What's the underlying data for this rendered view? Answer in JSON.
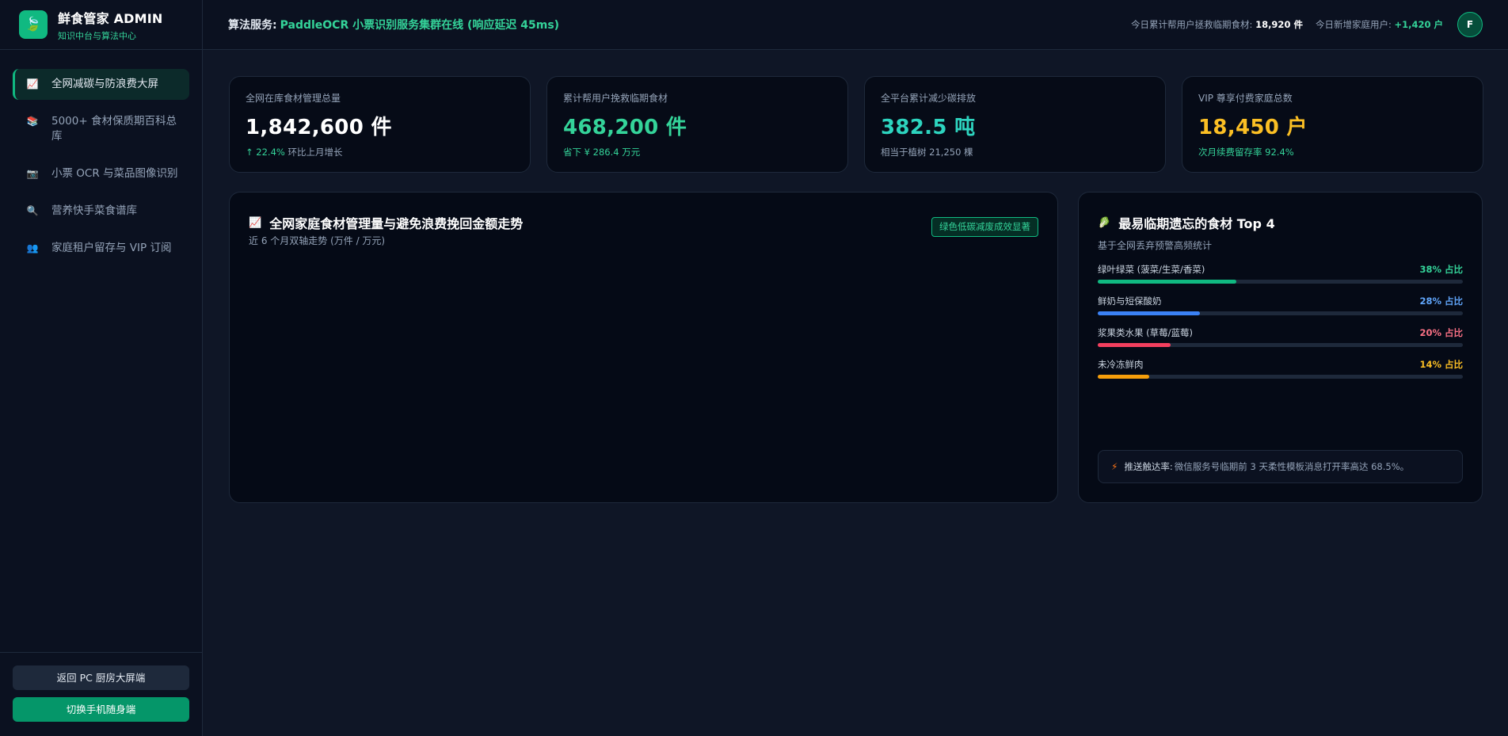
{
  "brand": {
    "title": "鲜食管家 ADMIN",
    "subtitle": "知识中台与算法中心",
    "logo_icon": "leaf-icon"
  },
  "nav": [
    {
      "label": "全网减碳与防浪费大屏",
      "icon": "chart-up-icon",
      "glyph": "📈",
      "active": true
    },
    {
      "label": "5000+ 食材保质期百科总库",
      "icon": "books-icon",
      "glyph": "📚",
      "active": false
    },
    {
      "label": "小票 OCR 与菜品图像识别",
      "icon": "camera-icon",
      "glyph": "📷",
      "active": false
    },
    {
      "label": "营养快手菜食谱库",
      "icon": "magnifier-icon",
      "glyph": "🔍",
      "active": false
    },
    {
      "label": "家庭租户留存与 VIP 订阅",
      "icon": "users-icon",
      "glyph": "👥",
      "active": false
    }
  ],
  "footer": {
    "back_pc": "返回 PC 厨房大屏端",
    "switch_mobile": "切换手机随身端"
  },
  "header": {
    "service_label": "算法服务:",
    "service_status": "PaddleOCR 小票识别服务集群在线 (响应延迟 45ms)",
    "stat1_label": "今日累计帮用户拯救临期食材:",
    "stat1_value": "18,920 件",
    "stat2_label": "今日新增家庭用户:",
    "stat2_value": "+1,420 户",
    "avatar": "F"
  },
  "kpis": [
    {
      "label": "全网在库食材管理总量",
      "value": "1,842,600 件",
      "sub_arrow": "↑ 22.4%",
      "sub": "环比上月增长"
    },
    {
      "label": "累计帮用户挽救临期食材",
      "value": "468,200 件",
      "sub": "省下 ¥ 286.4 万元"
    },
    {
      "label": "全平台累计减少碳排放",
      "value": "382.5 吨",
      "sub": "相当于植树 21,250 棵"
    },
    {
      "label": "VIP 尊享付费家庭总数",
      "value": "18,450 户",
      "sub": "次月续费留存率 92.4%"
    }
  ],
  "trend_panel": {
    "title": "全网家庭食材管理量与避免浪费挽回金额走势",
    "subtitle": "近 6 个月双轴走势 (万件 / 万元)",
    "badge": "绿色低碳减废成效显著"
  },
  "top_panel": {
    "title": "最易临期遗忘的食材 Top 4",
    "subtitle": "基于全网丢弃预警高频统计",
    "items": [
      {
        "name": "绿叶绿菜 (菠菜/生菜/香菜)",
        "pct_label": "38% 占比",
        "value": 0.38,
        "color": "#10b981",
        "text_color": "#34d399"
      },
      {
        "name": "鲜奶与短保酸奶",
        "pct_label": "28% 占比",
        "value": 0.28,
        "color": "#3b82f6",
        "text_color": "#60a5fa"
      },
      {
        "name": "浆果类水果 (草莓/蓝莓)",
        "pct_label": "20% 占比",
        "value": 0.2,
        "color": "#f43f5e",
        "text_color": "#fb7185"
      },
      {
        "name": "未冷冻鲜肉",
        "pct_label": "14% 占比",
        "value": 0.14,
        "color": "#f59e0b",
        "text_color": "#fbbf24"
      }
    ],
    "notice_label": "推送触达率:",
    "notice_text": "微信服务号临期前 3 天柔性模板消息打开率高达 68.5%。"
  }
}
